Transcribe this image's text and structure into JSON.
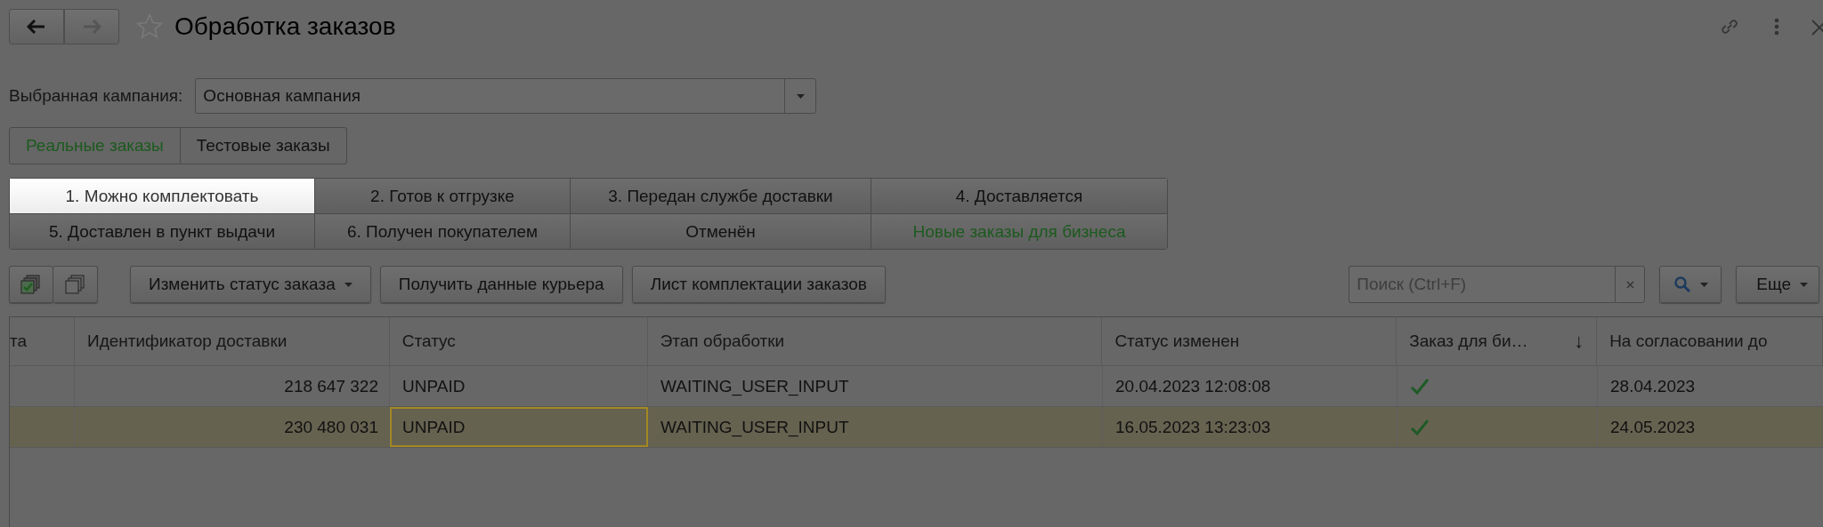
{
  "window": {
    "title": "Обработка заказов",
    "favorite": false
  },
  "campaign": {
    "label": "Выбранная кампания:",
    "value": "Основная кампания"
  },
  "source_tabs": [
    {
      "label": "Реальные заказы",
      "selected": true
    },
    {
      "label": "Тестовые заказы",
      "selected": false
    }
  ],
  "status_tabs": [
    {
      "label": "1. Можно комплектовать",
      "selected": true,
      "highlighted": false
    },
    {
      "label": "2. Готов к отгрузке",
      "selected": false,
      "highlighted": false
    },
    {
      "label": "3. Передан службе доставки",
      "selected": false,
      "highlighted": false
    },
    {
      "label": "4. Доставляется",
      "selected": false,
      "highlighted": false
    },
    {
      "label": "5. Доставлен в пункт выдачи",
      "selected": false,
      "highlighted": false
    },
    {
      "label": "6. Получен покупателем",
      "selected": false,
      "highlighted": false
    },
    {
      "label": "Отменён",
      "selected": false,
      "highlighted": false
    },
    {
      "label": "Новые заказы для бизнеса",
      "selected": false,
      "highlighted": true
    }
  ],
  "toolbar": {
    "buttons": [
      {
        "kind": "check-all"
      },
      {
        "kind": "uncheck-all"
      },
      {
        "kind": "dropdown",
        "label": "Изменить статус заказа"
      },
      {
        "kind": "plain",
        "label": "Получить данные курьера"
      },
      {
        "kind": "plain",
        "label": "Лист комплектации заказов"
      }
    ],
    "search": {
      "placeholder": "Поиск (Ctrl+F)"
    },
    "more": {
      "label": "Еще"
    }
  },
  "table": {
    "columns": [
      {
        "label": "та"
      },
      {
        "label": "Идентификатор доставки"
      },
      {
        "label": "Статус"
      },
      {
        "label": "Этап обработки"
      },
      {
        "label": "Статус изменен"
      },
      {
        "label": "Заказ для би…",
        "sort": "↓"
      },
      {
        "label": "На согласовании до"
      }
    ],
    "rows": [
      {
        "selected": false,
        "delivery_id": "218 647 322",
        "status": "UNPAID",
        "status_focused": false,
        "stage": "WAITING_USER_INPUT",
        "changed": "20.04.2023 12:08:08",
        "business": true,
        "due": "28.04.2023"
      },
      {
        "selected": true,
        "delivery_id": "230 480 031",
        "status": "UNPAID",
        "status_focused": true,
        "stage": "WAITING_USER_INPUT",
        "changed": "16.05.2023 13:23:03",
        "business": true,
        "due": "24.05.2023"
      }
    ]
  }
}
